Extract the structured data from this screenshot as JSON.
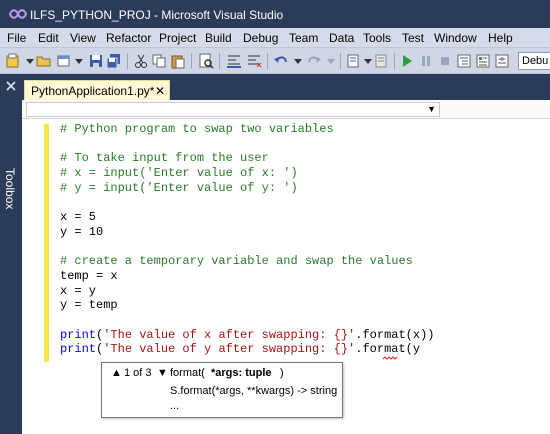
{
  "window": {
    "title": "ILFS_PYTHON_PROJ - Microsoft Visual Studio"
  },
  "menu": [
    "File",
    "Edit",
    "View",
    "Refactor",
    "Project",
    "Build",
    "Debug",
    "Team",
    "Data",
    "Tools",
    "Test",
    "Window",
    "Help"
  ],
  "toolbar": {
    "configuration_value": "Debu"
  },
  "toolbox": {
    "label": "Toolbox"
  },
  "tab": {
    "label": "PythonApplication1.py*",
    "close_glyph": "✕"
  },
  "code": {
    "lines": [
      {
        "text": "# Python program to swap two variables",
        "style": "comment"
      },
      {
        "text": "",
        "style": "plain"
      },
      {
        "text": "# To take input from the user",
        "style": "comment"
      },
      {
        "text": "# x = input('Enter value of x: ')",
        "style": "comment"
      },
      {
        "text": "# y = input('Enter value of y: ')",
        "style": "comment"
      },
      {
        "text": "",
        "style": "plain"
      },
      {
        "text": "x = 5",
        "style": "plain"
      },
      {
        "text": "y = 10",
        "style": "plain"
      },
      {
        "text": "",
        "style": "plain"
      },
      {
        "text": "# create a temporary variable and swap the values",
        "style": "comment"
      },
      {
        "text": "temp = x",
        "style": "plain"
      },
      {
        "text": "x = y",
        "style": "plain"
      },
      {
        "text": "y = temp",
        "style": "plain"
      },
      {
        "text": "",
        "style": "plain"
      },
      {
        "text": "print('The value of x after swapping: {}'.format(x))",
        "style": "print"
      },
      {
        "text": "print('The value of y after swapping: {}'.format(y",
        "style": "print"
      }
    ]
  },
  "param_info": {
    "overload_counter": "1 of 3",
    "signature_name": "format(",
    "signature_param": "*args: tuple",
    "signature_close": ")",
    "doc": "S.format(*args, **kwargs) -> string",
    "more": "..."
  },
  "colors": {
    "comment": "#2a7a2a",
    "string": "#a31515",
    "keyword": "#0000ff",
    "chrome": "#2b3c59",
    "change_bar": "#f4e64a",
    "tab_active": "#fff8d4"
  }
}
